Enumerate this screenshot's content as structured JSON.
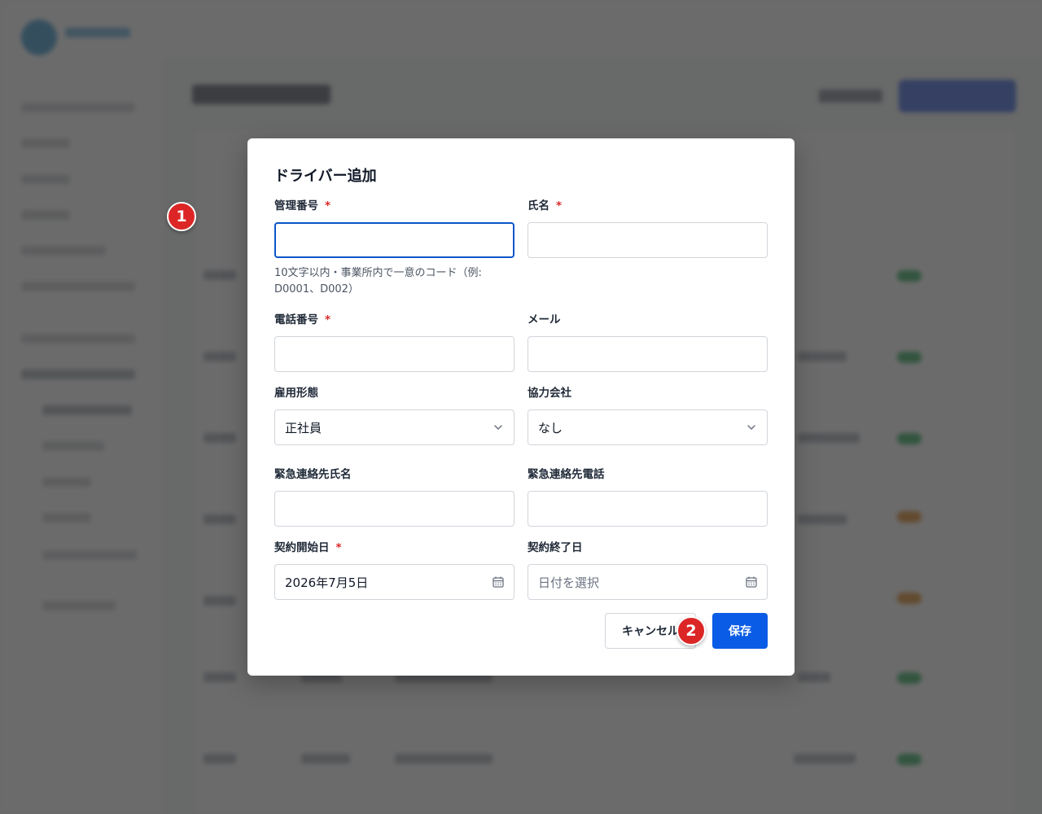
{
  "modal": {
    "title": "ドライバー追加",
    "fields": {
      "management_number": {
        "label": "管理番号",
        "required_mark": "*",
        "value": "",
        "hint": "10文字以内・事業所内で一意のコード（例: D0001、D002）"
      },
      "name": {
        "label": "氏名",
        "required_mark": "*",
        "value": ""
      },
      "phone": {
        "label": "電話番号",
        "required_mark": "*",
        "value": ""
      },
      "email": {
        "label": "メール",
        "value": ""
      },
      "employment_type": {
        "label": "雇用形態",
        "selected": "正社員"
      },
      "partner_company": {
        "label": "協力会社",
        "selected": "なし"
      },
      "emergency_name": {
        "label": "緊急連絡先氏名",
        "value": ""
      },
      "emergency_phone": {
        "label": "緊急連絡先電話",
        "value": ""
      },
      "contract_start": {
        "label": "契約開始日",
        "required_mark": "*",
        "value": "2026年7月5日"
      },
      "contract_end": {
        "label": "契約終了日",
        "placeholder": "日付を選択"
      }
    },
    "buttons": {
      "cancel": "キャンセル",
      "save": "保存"
    }
  },
  "markers": [
    "1",
    "2"
  ],
  "colors": {
    "primary": "#0a5ce6",
    "required": "#dc2626",
    "marker": "#dc2626",
    "focus": "#0a56c8"
  },
  "icons": {
    "select": "chevron-down-icon",
    "date": "calendar-icon"
  }
}
